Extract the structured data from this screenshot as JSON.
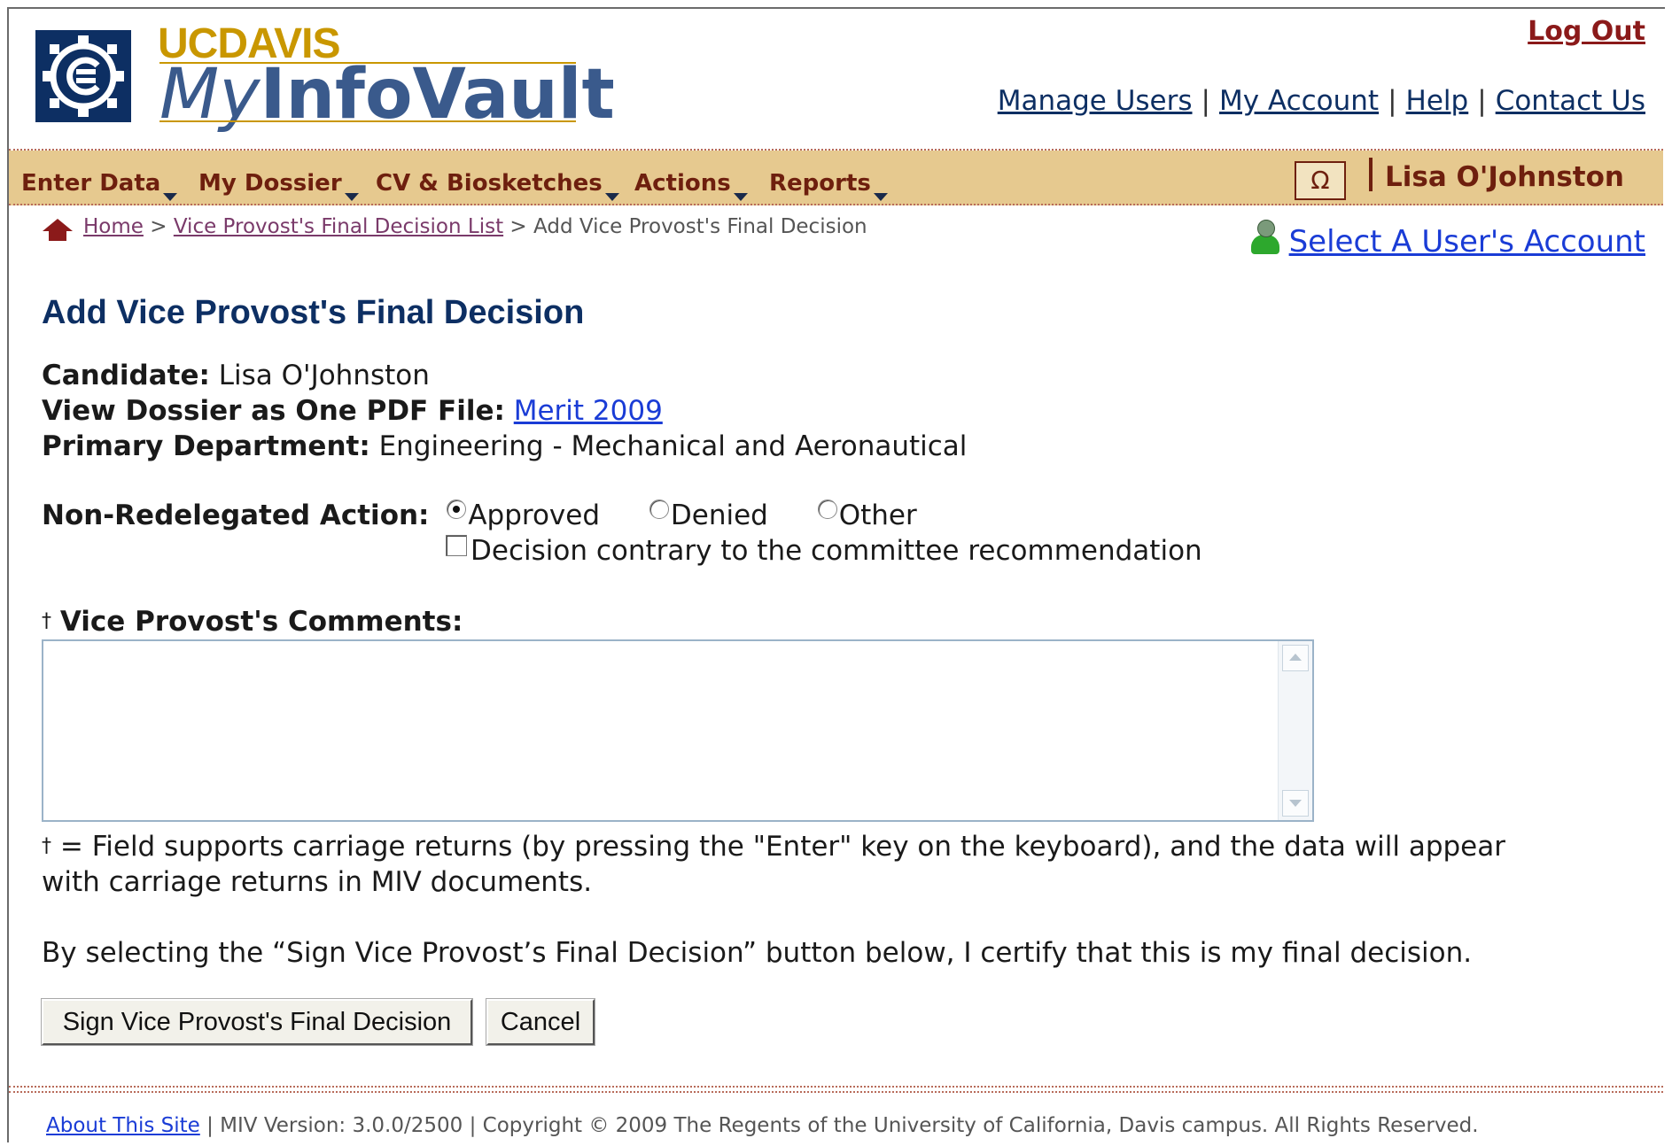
{
  "header": {
    "brand_uc": "UC",
    "brand_davis": "DAVIS",
    "brand_my": "My",
    "brand_infovault": "InfoVault",
    "logout": "Log Out",
    "links": [
      "Manage Users",
      "My Account",
      "Help",
      "Contact Us"
    ]
  },
  "nav": {
    "items": [
      "Enter Data",
      "My Dossier",
      "CV & Biosketches",
      "Actions",
      "Reports"
    ],
    "omega": "Ω",
    "user": "Lisa O'Johnston"
  },
  "breadcrumb": {
    "home": "Home",
    "sep": ">",
    "list": "Vice Provost's Final Decision List",
    "current": "Add Vice Provost's Final Decision"
  },
  "select_user": "Select A User's Account",
  "page_title": "Add Vice Provost's Final Decision",
  "candidate": {
    "label": "Candidate:",
    "value": "Lisa O'Johnston"
  },
  "dossier": {
    "label": "View Dossier as One PDF File:",
    "link": "Merit 2009"
  },
  "department": {
    "label": "Primary Department:",
    "value": "Engineering - Mechanical and Aeronautical"
  },
  "action": {
    "label": "Non-Redelegated Action:",
    "options": [
      "Approved",
      "Denied",
      "Other"
    ],
    "selected": "Approved",
    "contrary_label": "Decision contrary to the committee recommendation"
  },
  "comments": {
    "dagger": "†",
    "label": "Vice Provost's Comments:",
    "value": ""
  },
  "note": "= Field supports carriage returns (by pressing the \"Enter\" key on the keyboard), and the data will appear",
  "note2": "with carriage returns in MIV documents.",
  "certify": "By selecting the “Sign Vice Provost’s Final Decision” button below, I certify that this is my final decision.",
  "buttons": {
    "sign": "Sign Vice Provost's Final Decision",
    "cancel": "Cancel"
  },
  "footer": {
    "about": "About This Site",
    "version": "MIV Version: 3.0.0/2500",
    "copyright": "Copyright © 2009 The Regents of the University of California, Davis campus. All Rights Reserved."
  }
}
